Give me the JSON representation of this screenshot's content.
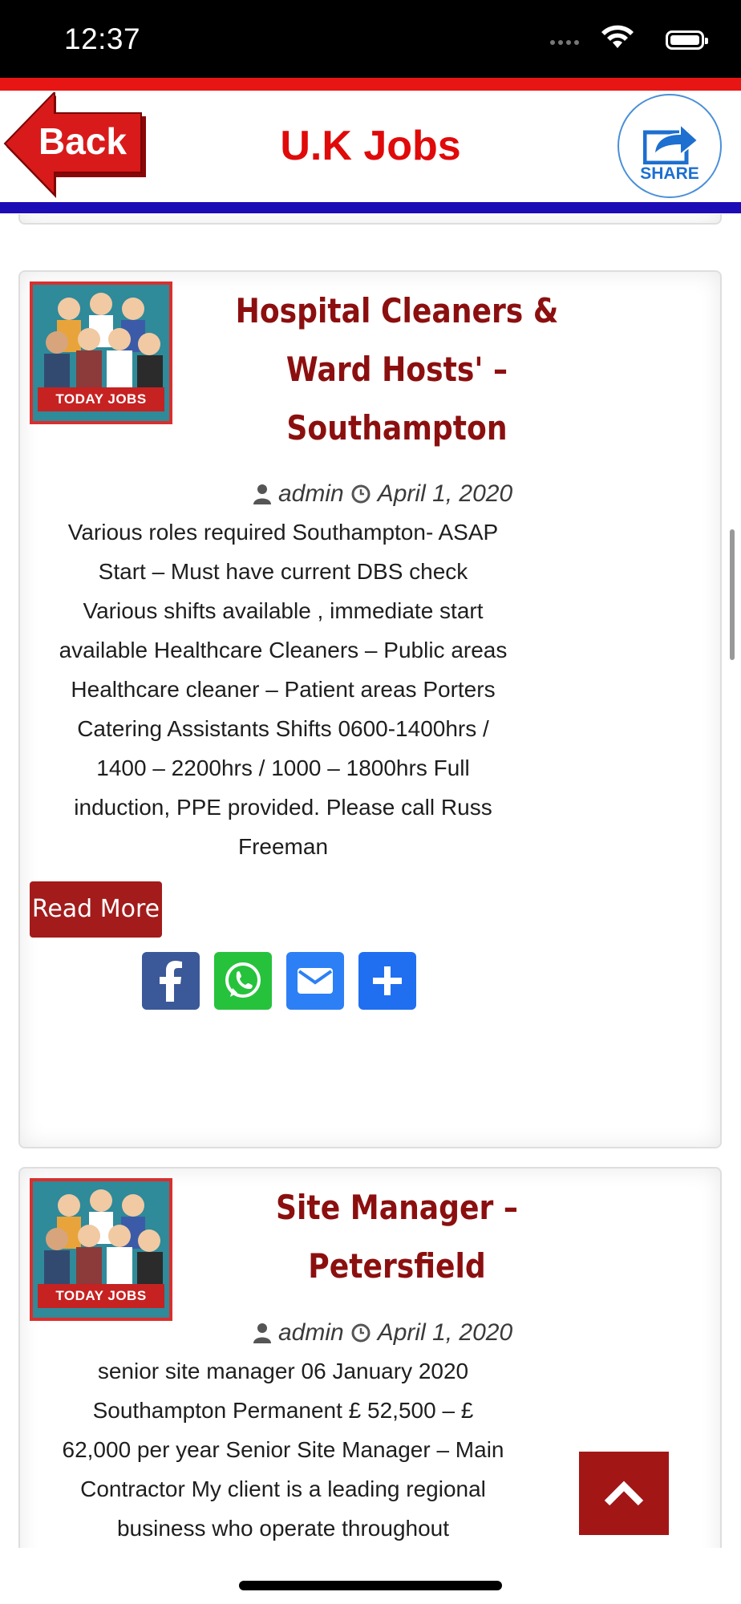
{
  "status_bar": {
    "time": "12:37"
  },
  "header": {
    "back_label": "Back",
    "title": "U.K Jobs",
    "share_label": "SHARE"
  },
  "posts": [
    {
      "thumb_label": "TODAY JOBS",
      "title_lines": [
        "Hospital Cleaners &",
        "Ward Hosts' –",
        "Southampton"
      ],
      "author": "admin",
      "date": "April 1, 2020",
      "excerpt_lines": [
        "Various roles required Southampton- ASAP",
        "Start – Must have current DBS check",
        "Various shifts available , immediate start",
        "available Healthcare Cleaners – Public areas",
        "Healthcare cleaner – Patient areas Porters",
        "Catering Assistants Shifts 0600-1400hrs /",
        "1400 – 2200hrs / 1000 – 1800hrs Full",
        "induction, PPE provided. Please call Russ",
        "Freeman"
      ],
      "read_more": "Read More",
      "share_icons": [
        "facebook-icon",
        "whatsapp-icon",
        "email-icon",
        "plus-icon"
      ]
    },
    {
      "thumb_label": "TODAY JOBS",
      "title_lines": [
        "Site Manager –",
        "Petersfield"
      ],
      "author": "admin",
      "date": "April 1, 2020",
      "excerpt_lines": [
        "senior site manager 06 January 2020",
        "Southampton Permanent £ 52,500 – £",
        "62,000 per year Senior Site Manager – Main",
        "Contractor My client is a leading regional",
        "business who operate throughout"
      ]
    }
  ],
  "colors": {
    "header_red": "#e81515",
    "header_blue": "#1b0cb5",
    "title_red": "#e00a0a",
    "post_title": "#8c0f0f",
    "button_red": "#a31b1b"
  }
}
